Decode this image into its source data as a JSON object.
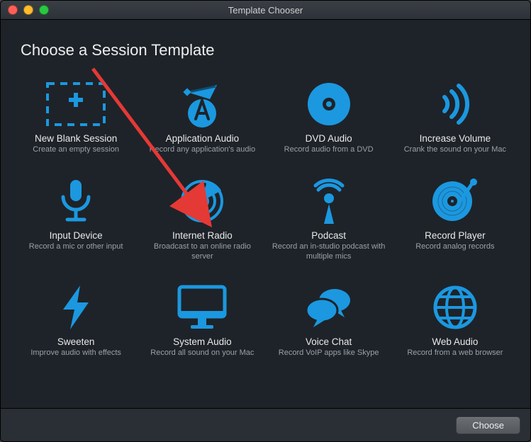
{
  "window_title": "Template Chooser",
  "heading": "Choose a Session Template",
  "choose_label": "Choose",
  "templates": [
    {
      "id": "new-blank-session",
      "name": "New Blank Session",
      "desc": "Create an empty session"
    },
    {
      "id": "application-audio",
      "name": "Application Audio",
      "desc": "Record any application's audio"
    },
    {
      "id": "dvd-audio",
      "name": "DVD Audio",
      "desc": "Record audio from a DVD"
    },
    {
      "id": "increase-volume",
      "name": "Increase Volume",
      "desc": "Crank the sound on your Mac"
    },
    {
      "id": "input-device",
      "name": "Input Device",
      "desc": "Record a mic or other input"
    },
    {
      "id": "internet-radio",
      "name": "Internet Radio",
      "desc": "Broadcast to an online radio server"
    },
    {
      "id": "podcast",
      "name": "Podcast",
      "desc": "Record an in-studio podcast with multiple mics"
    },
    {
      "id": "record-player",
      "name": "Record Player",
      "desc": "Record analog records"
    },
    {
      "id": "sweeten",
      "name": "Sweeten",
      "desc": "Improve audio with effects"
    },
    {
      "id": "system-audio",
      "name": "System Audio",
      "desc": "Record all sound on your Mac"
    },
    {
      "id": "voice-chat",
      "name": "Voice Chat",
      "desc": "Record VoIP apps like Skype"
    },
    {
      "id": "web-audio",
      "name": "Web Audio",
      "desc": "Record from a web browser"
    }
  ]
}
